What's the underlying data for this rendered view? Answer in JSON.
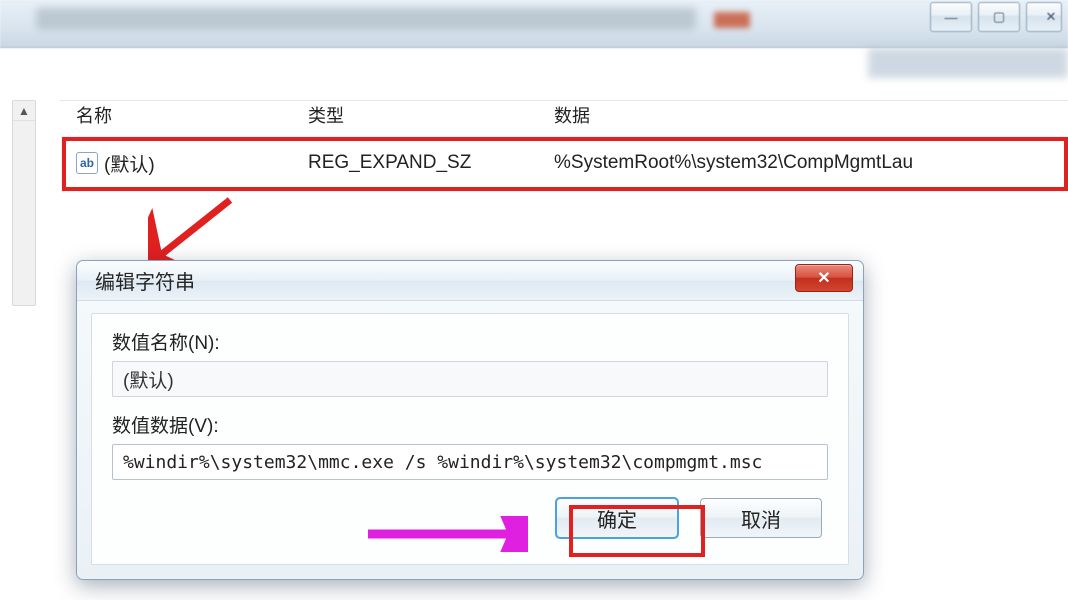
{
  "reg_list": {
    "headers": {
      "name": "名称",
      "type": "类型",
      "data": "数据"
    },
    "row": {
      "icon_text": "ab",
      "name": "(默认)",
      "type": "REG_EXPAND_SZ",
      "data": "%SystemRoot%\\system32\\CompMgmtLau"
    }
  },
  "dialog": {
    "title": "编辑字符串",
    "name_label": "数值名称(N):",
    "name_value": "(默认)",
    "data_label": "数值数据(V):",
    "data_value": "%windir%\\system32\\mmc.exe /s %windir%\\system32\\compmgmt.msc",
    "ok_label": "确定",
    "cancel_label": "取消",
    "close_glyph": "✕"
  },
  "window_controls": {
    "minimize": "—",
    "maximize": "▢",
    "close_half": "✕"
  }
}
